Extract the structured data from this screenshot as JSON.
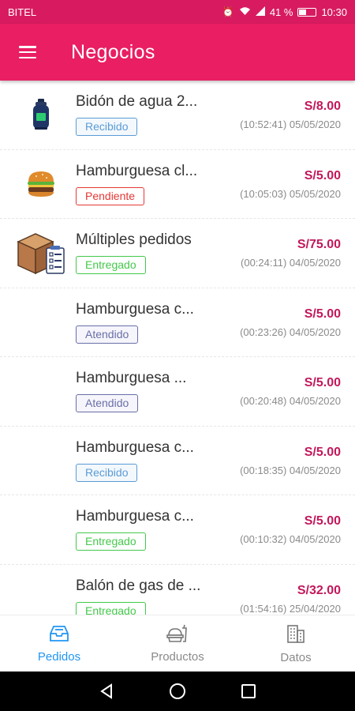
{
  "status_bar": {
    "carrier": "BITEL",
    "battery": "41 %",
    "time": "10:30"
  },
  "app_bar": {
    "title": "Negocios"
  },
  "colors": {
    "primary": "#e91e63",
    "status_bar": "#d81b60",
    "price": "#c2185b",
    "recibido": "#5a9bd5",
    "pendiente": "#e53935",
    "entregado": "#43c94a",
    "atendido": "#6a6fa8",
    "nav_active": "#2196f3"
  },
  "orders": [
    {
      "thumb": "gas-cylinder-icon",
      "name": "Bidón de agua 2...",
      "status": "Recibido",
      "price": "S/8.00",
      "date": "(10:52:41) 05/05/2020"
    },
    {
      "thumb": "burger-icon",
      "name": "Hamburguesa cl...",
      "status": "Pendiente",
      "price": "S/5.00",
      "date": "(10:05:03) 05/05/2020"
    },
    {
      "thumb": "box-checklist-icon",
      "name": "Múltiples pedidos",
      "status": "Entregado",
      "price": "S/75.00",
      "date": "(00:24:11) 04/05/2020"
    },
    {
      "thumb": "",
      "name": "Hamburguesa c...",
      "status": "Atendido",
      "price": "S/5.00",
      "date": "(00:23:26) 04/05/2020"
    },
    {
      "thumb": "",
      "name": "Hamburguesa ...",
      "status": "Atendido",
      "price": "S/5.00",
      "date": "(00:20:48) 04/05/2020"
    },
    {
      "thumb": "",
      "name": "Hamburguesa c...",
      "status": "Recibido",
      "price": "S/5.00",
      "date": "(00:18:35) 04/05/2020"
    },
    {
      "thumb": "",
      "name": "Hamburguesa c...",
      "status": "Entregado",
      "price": "S/5.00",
      "date": "(00:10:32) 04/05/2020"
    },
    {
      "thumb": "",
      "name": "Balón de gas de ...",
      "status": "Entregado",
      "price": "S/32.00",
      "date": "(01:54:16) 25/04/2020"
    }
  ],
  "bottom_nav": [
    {
      "label": "Pedidos",
      "icon": "inbox-tray-icon",
      "active": true
    },
    {
      "label": "Productos",
      "icon": "food-tray-icon",
      "active": false
    },
    {
      "label": "Datos",
      "icon": "building-icon",
      "active": false
    }
  ]
}
